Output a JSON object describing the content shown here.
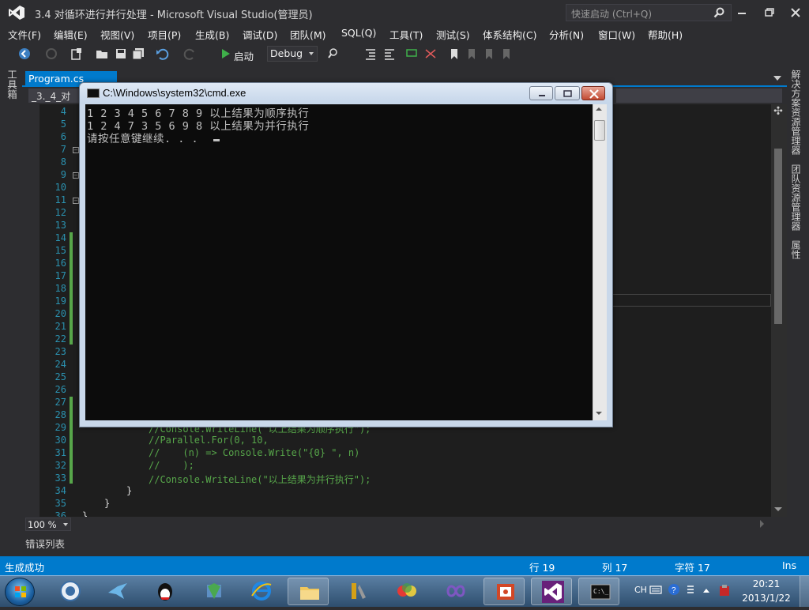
{
  "window": {
    "title": "3.4 对循环进行并行处理 - Microsoft Visual Studio(管理员)",
    "quick_launch_placeholder": "快速启动 (Ctrl+Q)"
  },
  "menu": [
    "文件(F)",
    "编辑(E)",
    "视图(V)",
    "项目(P)",
    "生成(B)",
    "调试(D)",
    "团队(M)",
    "SQL(Q)",
    "工具(T)",
    "测试(S)",
    "体系结构(C)",
    "分析(N)",
    "窗口(W)",
    "帮助(H)"
  ],
  "toolbar": {
    "start_label": "启动",
    "configuration": "Debug"
  },
  "side_tabs": {
    "left": "工具箱",
    "right": [
      "解决方案资源管理器",
      "团队资源管理器",
      "属性"
    ]
  },
  "document": {
    "tab_label": "Program.cs",
    "nav_left": "_3._4_对"
  },
  "editor": {
    "line_numbers": [
      "4",
      "5",
      "6",
      "7",
      "8",
      "9",
      "10",
      "11",
      "12",
      "13",
      "14",
      "15",
      "16",
      "17",
      "18",
      "19",
      "20",
      "21",
      "22",
      "23",
      "24",
      "25",
      "26",
      "27",
      "28",
      "29",
      "30",
      "31",
      "32",
      "33",
      "34",
      "35",
      "36"
    ],
    "code_lines": [
      "//Console.WriteLine(\"以上结果为顺序执行\");",
      "//Parallel.For(0, 10,",
      "//    (n) => Console.Write(\"{0} \", n)",
      "//    );",
      "//Console.WriteLine(\"以上结果为并行执行\");",
      "}",
      "}",
      "}"
    ],
    "zoom": "100 %"
  },
  "bottom_panel": {
    "error_list_tab": "错误列表"
  },
  "statusbar": {
    "message": "生成成功",
    "line": "行 19",
    "column": "列 17",
    "char": "字符 17",
    "mode": "Ins"
  },
  "cmd": {
    "title": "C:\\Windows\\system32\\cmd.exe",
    "lines": [
      "1 2 3 4 5 6 7 8 9 以上结果为顺序执行",
      "1 2 4 7 3 5 6 9 8 以上结果为并行执行",
      "请按任意键继续. . ."
    ]
  },
  "taskbar": {
    "tray_ime": "CH",
    "clock_time": "20:21",
    "clock_date": "2013/1/22"
  },
  "colors": {
    "accent": "#007acc",
    "ide_bg": "#2d2d30",
    "editor_bg": "#1e1e1e",
    "comment": "#57a64a",
    "line_number": "#2b91af"
  }
}
